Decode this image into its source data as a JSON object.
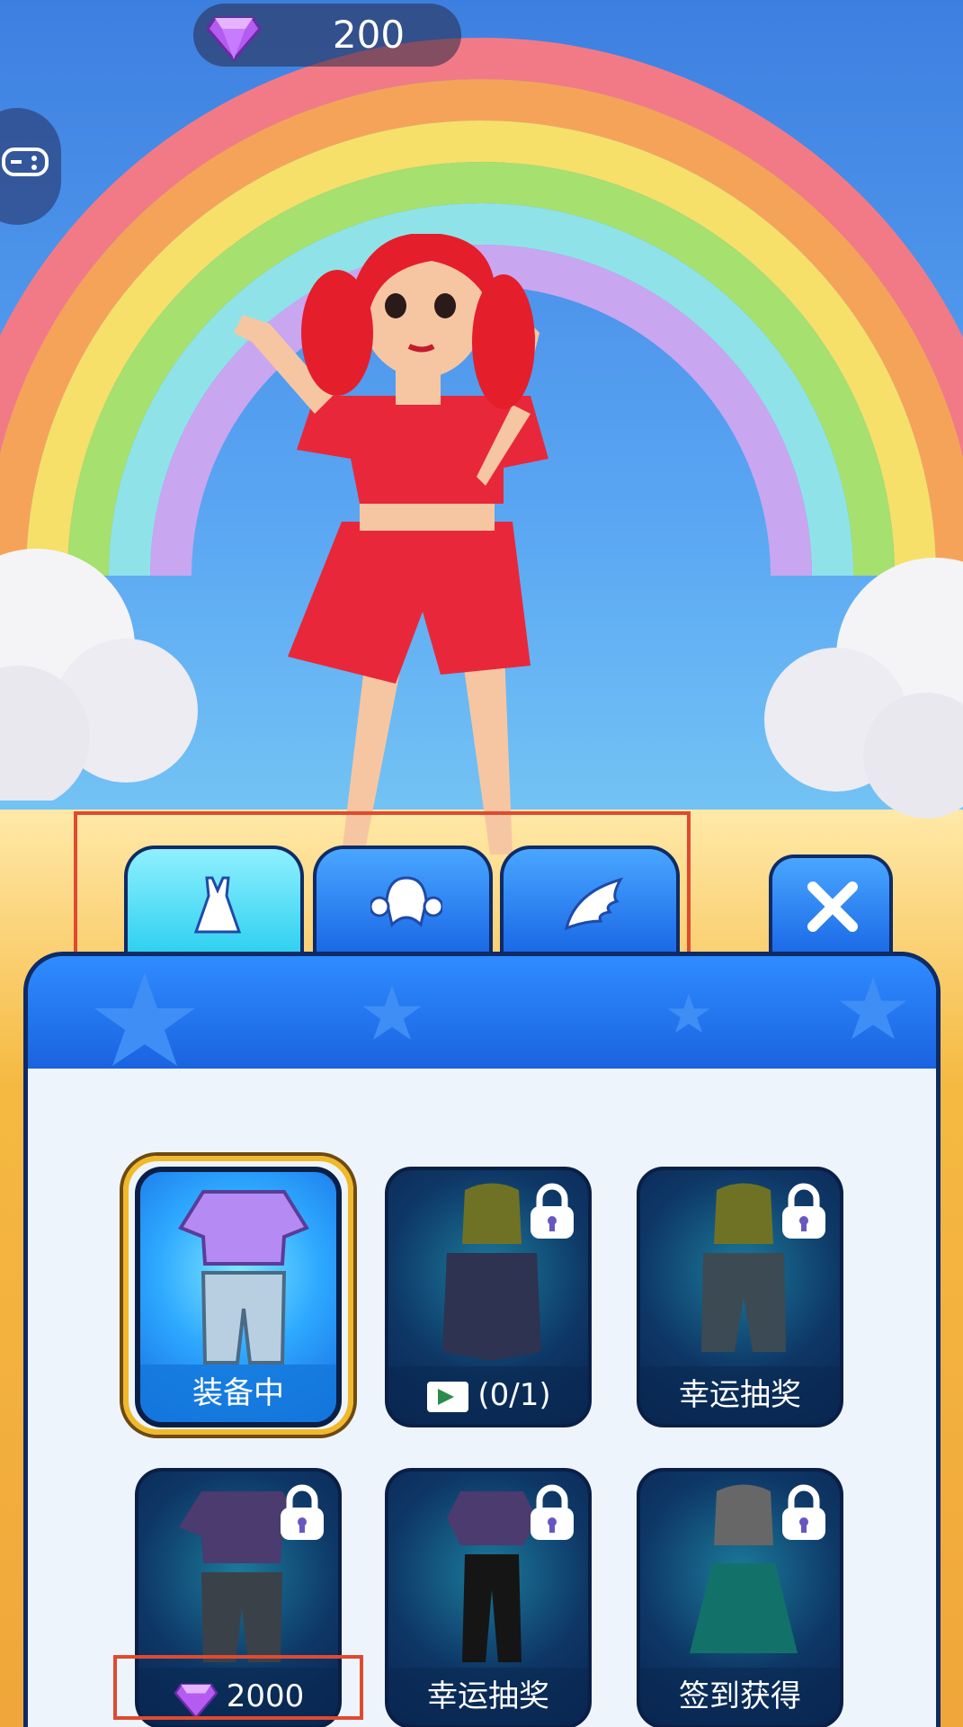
{
  "currency": {
    "gems": "200"
  },
  "tabs": [
    {
      "name": "outfit",
      "icon": "dress-icon",
      "active": true
    },
    {
      "name": "hair",
      "icon": "hair-icon",
      "active": false
    },
    {
      "name": "wings",
      "icon": "wing-icon",
      "active": false
    }
  ],
  "close_icon": "close-icon",
  "items": [
    {
      "label": "装备中",
      "state": "equipped",
      "locked": false
    },
    {
      "label": "(0/1)",
      "state": "watch-video",
      "locked": true
    },
    {
      "label": "幸运抽奖",
      "state": "lucky-draw",
      "locked": true
    },
    {
      "label": "2000",
      "state": "gem-price",
      "locked": true
    },
    {
      "label": "幸运抽奖",
      "state": "lucky-draw",
      "locked": true
    },
    {
      "label": "签到获得",
      "state": "check-in",
      "locked": true
    }
  ],
  "colors": {
    "accent": "#1c6fe6",
    "highlight": "#e04a30",
    "equipped_border": "#f0b92a"
  }
}
